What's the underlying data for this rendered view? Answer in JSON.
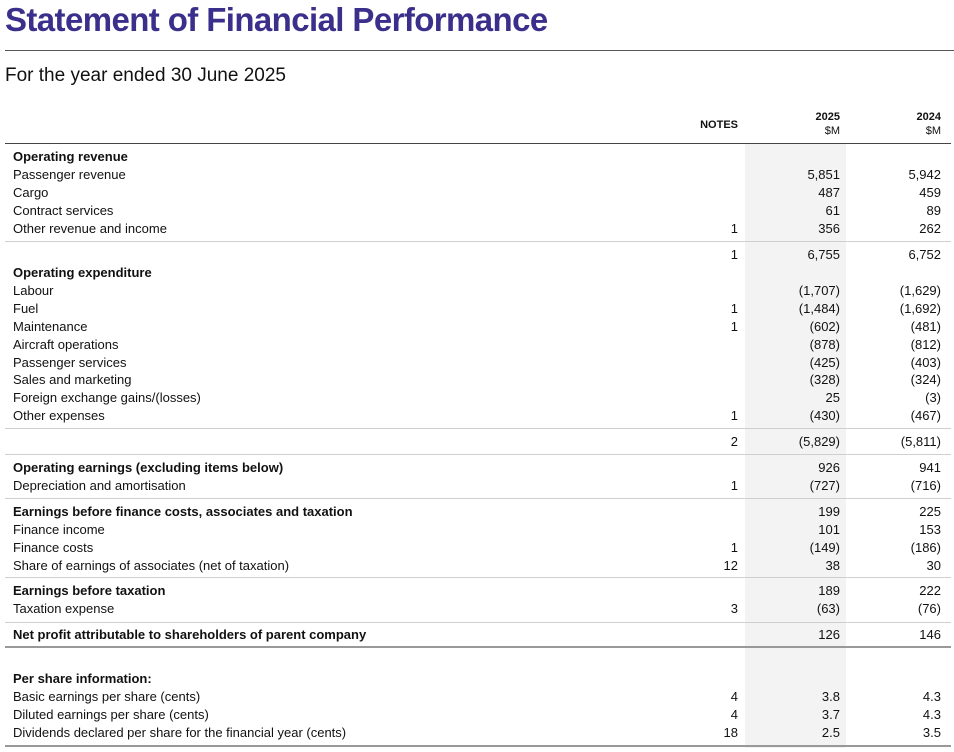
{
  "page": {
    "title": "Statement of Financial Performance",
    "subtitle": "For the year ended 30 June 2025"
  },
  "columns": {
    "notes": "NOTES",
    "y2025": "2025",
    "y2024": "2024",
    "unit_2025": "$M",
    "unit_2024": "$M"
  },
  "rows": [
    {
      "label": "Operating revenue",
      "note": "",
      "v2025": "",
      "v2024": "",
      "bold": true
    },
    {
      "label": "Passenger revenue",
      "note": "",
      "v2025": "5,851",
      "v2024": "5,942"
    },
    {
      "label": "Cargo",
      "note": "",
      "v2025": "487",
      "v2024": "459"
    },
    {
      "label": "Contract services",
      "note": "",
      "v2025": "61",
      "v2024": "89"
    },
    {
      "label": "Other revenue and income",
      "note": "1",
      "v2025": "356",
      "v2024": "262"
    },
    {
      "label": "",
      "note": "1",
      "v2025": "6,755",
      "v2024": "6,752"
    },
    {
      "label": "Operating expenditure",
      "note": "",
      "v2025": "",
      "v2024": "",
      "bold": true
    },
    {
      "label": "Labour",
      "note": "",
      "v2025": "(1,707)",
      "v2024": "(1,629)"
    },
    {
      "label": "Fuel",
      "note": "1",
      "v2025": "(1,484)",
      "v2024": "(1,692)"
    },
    {
      "label": "Maintenance",
      "note": "1",
      "v2025": "(602)",
      "v2024": "(481)"
    },
    {
      "label": "Aircraft operations",
      "note": "",
      "v2025": "(878)",
      "v2024": "(812)"
    },
    {
      "label": "Passenger services",
      "note": "",
      "v2025": "(425)",
      "v2024": "(403)"
    },
    {
      "label": "Sales and marketing",
      "note": "",
      "v2025": "(328)",
      "v2024": "(324)"
    },
    {
      "label": "Foreign exchange gains/(losses)",
      "note": "",
      "v2025": "25",
      "v2024": "(3)"
    },
    {
      "label": "Other expenses",
      "note": "1",
      "v2025": "(430)",
      "v2024": "(467)"
    },
    {
      "label": "",
      "note": "2",
      "v2025": "(5,829)",
      "v2024": "(5,811)"
    },
    {
      "label": "Operating earnings (excluding items below)",
      "note": "",
      "v2025": "926",
      "v2024": "941",
      "bold": true
    },
    {
      "label": "Depreciation and amortisation",
      "note": "1",
      "v2025": "(727)",
      "v2024": "(716)"
    },
    {
      "label": "Earnings before finance costs, associates and taxation",
      "note": "",
      "v2025": "199",
      "v2024": "225",
      "bold": true
    },
    {
      "label": "Finance income",
      "note": "",
      "v2025": "101",
      "v2024": "153"
    },
    {
      "label": "Finance costs",
      "note": "1",
      "v2025": "(149)",
      "v2024": "(186)"
    },
    {
      "label": "Share of earnings of associates (net of taxation)",
      "note": "12",
      "v2025": "38",
      "v2024": "30"
    },
    {
      "label": "Earnings before taxation",
      "note": "",
      "v2025": "189",
      "v2024": "222",
      "bold": true
    },
    {
      "label": "Taxation expense",
      "note": "3",
      "v2025": "(63)",
      "v2024": "(76)"
    },
    {
      "label": "Net profit attributable to shareholders of parent company",
      "note": "",
      "v2025": "126",
      "v2024": "146",
      "bold": true
    },
    {
      "label": "Per share information:",
      "note": "",
      "v2025": "",
      "v2024": "",
      "bold": true
    },
    {
      "label": "Basic earnings per share (cents)",
      "note": "4",
      "v2025": "3.8",
      "v2024": "4.3"
    },
    {
      "label": "Diluted earnings per share (cents)",
      "note": "4",
      "v2025": "3.7",
      "v2024": "4.3"
    },
    {
      "label": "Dividends declared per share for the financial year (cents)",
      "note": "18",
      "v2025": "2.5",
      "v2024": "3.5"
    }
  ]
}
